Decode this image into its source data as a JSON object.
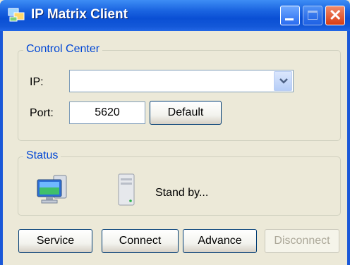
{
  "window": {
    "title": "IP Matrix Client",
    "app_icon": "app-icon",
    "controls": [
      "minimize-icon",
      "maximize-icon",
      "close-icon"
    ]
  },
  "control_center": {
    "legend": "Control Center",
    "ip_label": "IP:",
    "ip_value": "",
    "port_label": "Port:",
    "port_value": "5620",
    "default_button": "Default"
  },
  "status": {
    "legend": "Status",
    "computer_icon": "computer-icon",
    "server_icon": "server-icon",
    "text": "Stand by..."
  },
  "buttons": {
    "service": "Service",
    "connect": "Connect",
    "advance": "Advance",
    "disconnect": "Disconnect"
  },
  "colors": {
    "titlebar": "#0a4fd4",
    "legend_text": "#0046d5",
    "window_bg": "#ece9d8",
    "close": "#d83c13"
  }
}
